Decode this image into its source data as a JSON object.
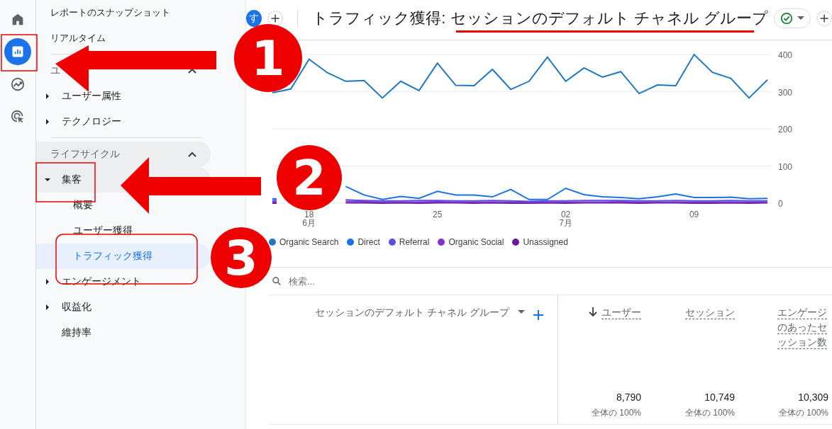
{
  "rail": [
    {
      "kind": "home",
      "selected": false
    },
    {
      "kind": "reports",
      "selected": true
    },
    {
      "kind": "explore",
      "selected": false
    },
    {
      "kind": "advertising",
      "selected": false
    }
  ],
  "nav": {
    "top": [
      {
        "label": "レポートのスナップショット"
      },
      {
        "label": "リアルタイム"
      }
    ],
    "sections": [
      {
        "label": "ユ",
        "expanded": true,
        "highlighted": false,
        "items": [
          {
            "label": "ユーザー属性",
            "kind": "group",
            "expanded": false,
            "highlighted": false
          },
          {
            "label": "テクノロジー",
            "kind": "group",
            "expanded": false,
            "highlighted": false
          }
        ]
      },
      {
        "label": "ライフサイクル",
        "expanded": true,
        "highlighted": true,
        "items": [
          {
            "label": "集客",
            "kind": "group",
            "expanded": true,
            "highlighted": true,
            "children": [
              {
                "label": "概要",
                "selected": false
              },
              {
                "label": "ユーザー獲得",
                "selected": false
              },
              {
                "label": "トラフィック獲得",
                "selected": true
              }
            ]
          },
          {
            "label": "エンゲージメント",
            "kind": "group",
            "expanded": false,
            "highlighted": false
          },
          {
            "label": "収益化",
            "kind": "group",
            "expanded": false,
            "highlighted": false
          },
          {
            "label": "維持率",
            "kind": "link",
            "highlighted": false
          }
        ]
      }
    ]
  },
  "header": {
    "avatar": "す",
    "title": "トラフィック獲得: セッションのデフォルト チャネル グループ"
  },
  "chart": {
    "chart_data": {
      "type": "line",
      "grid": true,
      "categories": [
        null,
        null,
        "18\n6月",
        null,
        null,
        null,
        null,
        null,
        null,
        "25",
        null,
        null,
        null,
        null,
        null,
        null,
        "02\n7月",
        null,
        null,
        null,
        null,
        null,
        null,
        "09",
        null,
        null,
        null,
        null
      ],
      "series": [
        {
          "name": "Organic Search",
          "color": "#1f78c1",
          "values": [
            297,
            307,
            387,
            351,
            328,
            330,
            283,
            328,
            303,
            377,
            317,
            316,
            360,
            306,
            328,
            393,
            328,
            364,
            339,
            354,
            295,
            318,
            316,
            400,
            352,
            336,
            283,
            332
          ]
        },
        {
          "name": "Direct",
          "color": "#1a73e8",
          "values": [
            12,
            null,
            null,
            null,
            45,
            22,
            10,
            18,
            13,
            32,
            22,
            22,
            17,
            37,
            10,
            10,
            40,
            23,
            17,
            15,
            12,
            17,
            25,
            15,
            15,
            16,
            12,
            13
          ]
        },
        {
          "name": "Referral",
          "color": "#5b4ee5",
          "values": [
            8,
            null,
            null,
            null,
            9,
            7,
            6,
            6,
            7,
            7,
            6,
            6,
            7,
            6,
            5,
            6,
            6,
            7,
            7,
            7,
            6,
            6,
            7,
            6,
            6,
            7,
            6,
            6
          ]
        },
        {
          "name": "Organic Social",
          "color": "#8430ce",
          "values": [
            4,
            null,
            null,
            null,
            5,
            4,
            3,
            3,
            3,
            4,
            3,
            3,
            3,
            3,
            2,
            3,
            3,
            3,
            3,
            4,
            3,
            3,
            3,
            3,
            3,
            3,
            3,
            3
          ]
        },
        {
          "name": "Unassigned",
          "color": "#6a1b9a",
          "values": [
            0,
            null,
            null,
            null,
            1,
            1,
            0,
            1,
            0,
            1,
            1,
            0,
            1,
            0,
            0,
            1,
            0,
            1,
            1,
            1,
            0,
            1,
            1,
            0,
            0,
            1,
            0,
            1
          ]
        }
      ],
      "ylim": [
        0,
        400
      ],
      "yticks": [
        0,
        100,
        200,
        300,
        400
      ]
    }
  },
  "table": {
    "search": {
      "placeholder": "検索..."
    },
    "dimension": "セッションのデフォルト チャネル グループ",
    "columns": [
      {
        "label": "ユーザー",
        "sorted": true,
        "total": "8,790",
        "share": "全体の 100%"
      },
      {
        "label": "セッション",
        "sorted": false,
        "total": "10,749",
        "share": "全体の 100%"
      },
      {
        "label": "エンゲージのあったセッション数",
        "sorted": false,
        "total": "10,309",
        "share": "全体の 100%"
      }
    ]
  },
  "annotations": {
    "markers": [
      {
        "label": "1"
      },
      {
        "label": "2"
      },
      {
        "label": "3"
      }
    ]
  }
}
